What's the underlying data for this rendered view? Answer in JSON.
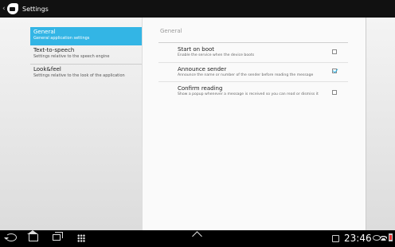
{
  "action_bar": {
    "title": "Settings",
    "app_icon": "app-logo-icon",
    "up_icon": "chevron-left-icon"
  },
  "headers": [
    {
      "title": "General",
      "summary": "General application settings",
      "selected": true
    },
    {
      "title": "Text-to-speech",
      "summary": "Settings relative to the speech engine",
      "selected": false
    },
    {
      "title": "Look&feel",
      "summary": "Settings relative to the look of the application",
      "selected": false
    }
  ],
  "detail": {
    "category": "General",
    "prefs": [
      {
        "title": "Start on boot",
        "summary": "Enable the service when the device boots",
        "checked": false
      },
      {
        "title": "Announce sender",
        "summary": "Announce the name or number of the sender before reading the message",
        "checked": true
      },
      {
        "title": "Confirm reading",
        "summary": "Show a popup whenever a message is received so you can read or dismiss it",
        "checked": false
      }
    ]
  },
  "system_bar": {
    "time": "23:46",
    "icons": [
      "back-icon",
      "home-icon",
      "recent-apps-icon",
      "apps-grid-icon",
      "up-arrow-icon",
      "usb-icon",
      "eye-icon",
      "wifi-icon",
      "battery-icon"
    ]
  },
  "colors": {
    "accent": "#33b5e5",
    "action_bar": "#111111",
    "nav_bar": "#000000"
  }
}
